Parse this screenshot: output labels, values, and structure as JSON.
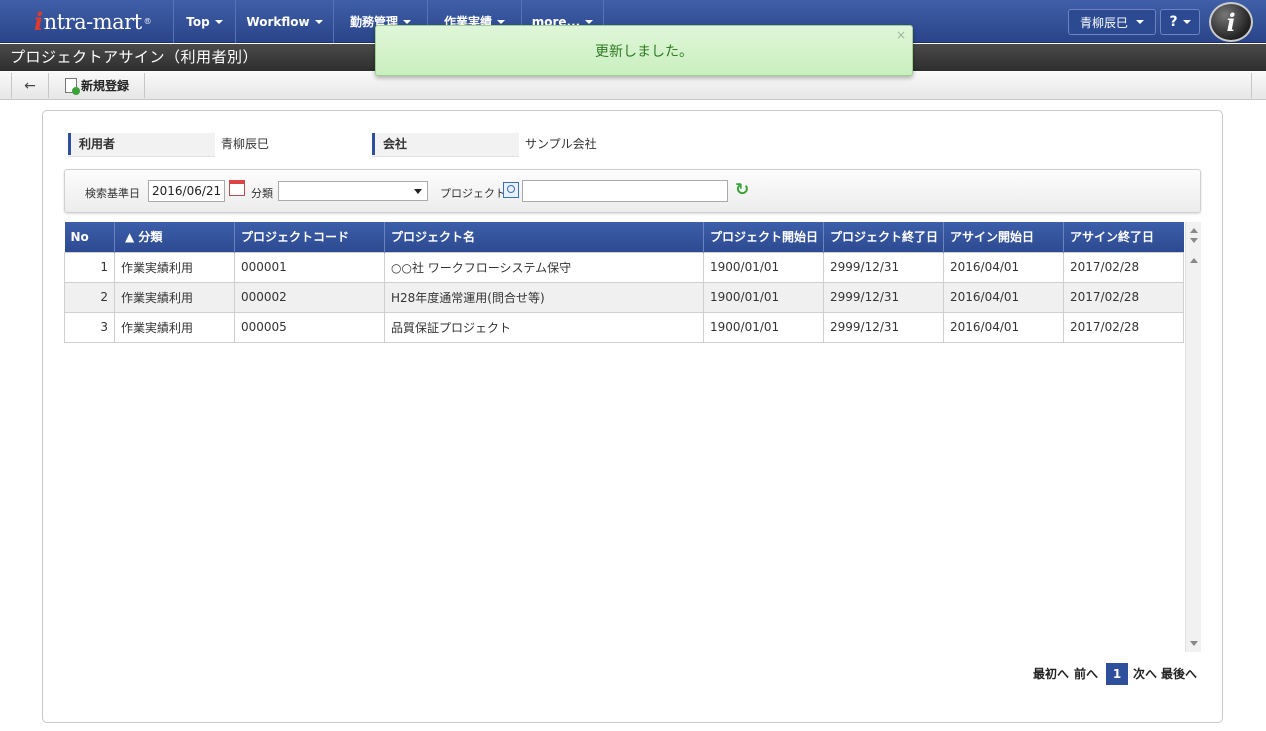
{
  "nav": {
    "logo": "ntra-mart",
    "logo_mark": "i",
    "logo_reg": "®",
    "items": [
      {
        "label": "Top"
      },
      {
        "label": "Workflow"
      },
      {
        "label": "勤務管理"
      },
      {
        "label": "作業実績"
      },
      {
        "label": "more..."
      }
    ],
    "user": "青柳辰巳",
    "help": "?",
    "brand_badge": "i"
  },
  "page": {
    "title": "プロジェクトアサイン（利用者別）"
  },
  "toolbar": {
    "back_icon": "arrow-left-icon",
    "new_label": "新規登録"
  },
  "toast": {
    "message": "更新しました。",
    "close": "×"
  },
  "info": {
    "user_label": "利用者",
    "user_value": "青柳辰巳",
    "company_label": "会社",
    "company_value": "サンプル会社"
  },
  "search": {
    "date_label": "検索基準日",
    "date_value": "2016/06/21",
    "category_label": "分類",
    "category_value": "",
    "project_label": "プロジェクト",
    "project_value": ""
  },
  "grid": {
    "columns": [
      "No",
      "▲ 分類",
      "プロジェクトコード",
      "プロジェクト名",
      "プロジェクト開始日",
      "プロジェクト終了日",
      "アサイン開始日",
      "アサイン終了日"
    ],
    "rows": [
      {
        "no": "1",
        "category": "作業実績利用",
        "code": "000001",
        "name": "○○社 ワークフローシステム保守",
        "p_start": "1900/01/01",
        "p_end": "2999/12/31",
        "a_start": "2016/04/01",
        "a_end": "2017/02/28"
      },
      {
        "no": "2",
        "category": "作業実績利用",
        "code": "000002",
        "name": "H28年度通常運用(問合せ等)",
        "p_start": "1900/01/01",
        "p_end": "2999/12/31",
        "a_start": "2016/04/01",
        "a_end": "2017/02/28"
      },
      {
        "no": "3",
        "category": "作業実績利用",
        "code": "000005",
        "name": "品質保証プロジェクト",
        "p_start": "1900/01/01",
        "p_end": "2999/12/31",
        "a_start": "2016/04/01",
        "a_end": "2017/02/28"
      }
    ]
  },
  "pager": {
    "first": "最初へ",
    "prev": "前へ",
    "current": "1",
    "next": "次へ",
    "last": "最後へ"
  },
  "colors": {
    "nav": "#2f4e96",
    "accent": "#2e4f9b",
    "toast": "#dff6d8"
  }
}
